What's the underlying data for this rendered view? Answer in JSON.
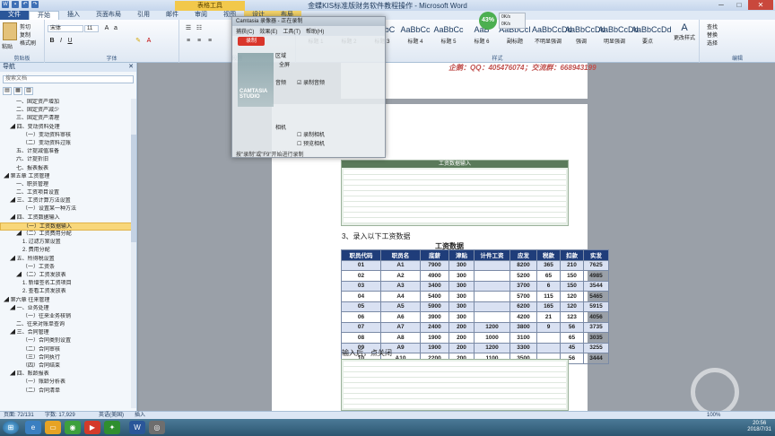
{
  "window": {
    "title": "金蝶KIS标准版财务软件教程操作 - Microsoft Word",
    "min": "─",
    "max": "□",
    "close": "✕"
  },
  "ribbon_tabs": [
    "文件",
    "开始",
    "插入",
    "页面布局",
    "引用",
    "邮件",
    "审阅",
    "视图",
    "设计",
    "布局"
  ],
  "ribbon_context": "表格工具",
  "ribbon": {
    "clipboard": {
      "label": "剪贴板",
      "paste": "粘贴",
      "cut": "剪切",
      "copy": "复制",
      "format_painter": "格式刷"
    },
    "font": {
      "label": "字体",
      "name": "宋体",
      "size": "11",
      "bold": "B",
      "italic": "I",
      "underline": "U"
    },
    "paragraph": {
      "label": "段落"
    },
    "styles": {
      "label": "样式",
      "items": [
        {
          "preview": "AaBb",
          "name": "标题 1"
        },
        {
          "preview": "AaBbC",
          "name": "标题 2"
        },
        {
          "preview": "AaBbC",
          "name": "标题 3"
        },
        {
          "preview": "AaBbCc",
          "name": "标题 4"
        },
        {
          "preview": "AaBbCc",
          "name": "标题 5"
        },
        {
          "preview": "AaB",
          "name": "标题 6"
        },
        {
          "preview": "AaBbCcI",
          "name": "副标题"
        },
        {
          "preview": "AaBbCcDd",
          "name": "不明显强调"
        },
        {
          "preview": "AaBbCcDd",
          "name": "强调"
        },
        {
          "preview": "AaBbCcDd",
          "name": "明显强调"
        },
        {
          "preview": "AaBbCcDd",
          "name": "要点"
        }
      ],
      "change": "更改样式"
    },
    "editing": {
      "label": "编辑",
      "find": "查找",
      "replace": "替换",
      "select": "选择"
    }
  },
  "nav": {
    "title": "导航",
    "search_placeholder": "搜索文档",
    "items": [
      {
        "t": "一、固定资产增加",
        "lv": 2
      },
      {
        "t": "二、固定资产减少",
        "lv": 2
      },
      {
        "t": "三、固定资产清理",
        "lv": 2
      },
      {
        "t": "◢ 四、变动资料处理",
        "lv": 1
      },
      {
        "t": "（一）变动资料审核",
        "lv": 3
      },
      {
        "t": "（二）变动资料过账",
        "lv": 3
      },
      {
        "t": "五、计提减值准备",
        "lv": 2
      },
      {
        "t": "六、计提折旧",
        "lv": 2
      },
      {
        "t": "七、报表报表",
        "lv": 2
      },
      {
        "t": "◢ 第五章 工资管理",
        "lv": 0
      },
      {
        "t": "一、职员管理",
        "lv": 2
      },
      {
        "t": "二、工资项目设置",
        "lv": 2
      },
      {
        "t": "◢ 三、工资计算方法设置",
        "lv": 1
      },
      {
        "t": "（一）设置某一种方法",
        "lv": 3
      },
      {
        "t": "◢ 四、工资数据输入",
        "lv": 1
      },
      {
        "t": "（一）工资数据输入",
        "lv": 3,
        "sel": true
      },
      {
        "t": "◢ （二）工资费用分配",
        "lv": 2
      },
      {
        "t": "1. 过滤方案设置",
        "lv": 3
      },
      {
        "t": "2. 费用分配",
        "lv": 3
      },
      {
        "t": "◢ 五、所得税设置",
        "lv": 1
      },
      {
        "t": "（一）工资条",
        "lv": 3
      },
      {
        "t": "◢ （二）工资发放表",
        "lv": 2
      },
      {
        "t": "1. 新增签名工资项目",
        "lv": 3
      },
      {
        "t": "2. 查看工资发放表",
        "lv": 3
      },
      {
        "t": "◢ 第六章 往来管理",
        "lv": 0
      },
      {
        "t": "◢ 一、业务处理",
        "lv": 1
      },
      {
        "t": "（一）往来业务核销",
        "lv": 3
      },
      {
        "t": "二、往来对账单查询",
        "lv": 2
      },
      {
        "t": "◢ 三、合同管理",
        "lv": 1
      },
      {
        "t": "（一）合同类别设置",
        "lv": 3
      },
      {
        "t": "（二）合同审核",
        "lv": 3
      },
      {
        "t": "（三）合同执行",
        "lv": 3
      },
      {
        "t": "（四）合同结束",
        "lv": 3
      },
      {
        "t": "◢ 四、账龄报表",
        "lv": 1
      },
      {
        "t": "（一）账龄分析表",
        "lv": 3
      },
      {
        "t": "（二）合同清单",
        "lv": 3
      }
    ]
  },
  "doc": {
    "header_contact": "企鹅：QQ：405476074；交流群：668943199",
    "step3": "3、录入以下工资数据",
    "table_title": "工资数据",
    "after_input": "输入后，点关闭",
    "headers": [
      "职员代码",
      "职员名",
      "底薪",
      "津贴",
      "计件工资",
      "应发",
      "税款",
      "扣款",
      "实发"
    ],
    "rows": [
      [
        "01",
        "A1",
        "7900",
        "300",
        "",
        "8200",
        "365",
        "210",
        "7625"
      ],
      [
        "02",
        "A2",
        "4900",
        "300",
        "",
        "5200",
        "65",
        "150",
        "4985"
      ],
      [
        "03",
        "A3",
        "3400",
        "300",
        "",
        "3700",
        "6",
        "150",
        "3544"
      ],
      [
        "04",
        "A4",
        "5400",
        "300",
        "",
        "5700",
        "115",
        "120",
        "5465"
      ],
      [
        "05",
        "A5",
        "5900",
        "300",
        "",
        "6200",
        "165",
        "120",
        "5915"
      ],
      [
        "06",
        "A6",
        "3900",
        "300",
        "",
        "4200",
        "21",
        "123",
        "4056"
      ],
      [
        "07",
        "A7",
        "2400",
        "200",
        "1200",
        "3800",
        "9",
        "56",
        "3735"
      ],
      [
        "08",
        "A8",
        "1900",
        "200",
        "1000",
        "3100",
        "",
        "65",
        "3035"
      ],
      [
        "09",
        "A9",
        "1900",
        "200",
        "1200",
        "3300",
        "",
        "45",
        "3255"
      ],
      [
        "10",
        "A10",
        "2200",
        "200",
        "1100",
        "3500",
        "",
        "56",
        "3444"
      ]
    ],
    "mock_title": "工资数据输入"
  },
  "camtasia": {
    "title": "Camtasia 录像器 - 正在录制",
    "menu": [
      "捕获(C)",
      "效果(E)",
      "工具(T)",
      "帮助(H)"
    ],
    "record": "录制",
    "area": "区域",
    "full_screen": "全屏",
    "screen": "屏幕",
    "audio": "音频",
    "record_audio": "录制音频",
    "webcam": "相机",
    "record_webcam": "录制相机",
    "preview": "预览相机",
    "hint": "按\"录制\"或\"F9\"开始进行录制",
    "watermark": "CAMTASIA STUDIO"
  },
  "status": {
    "page": "页面: 72/131",
    "words": "字数: 17,929",
    "lang": "英语(美国)",
    "insert": "插入",
    "zoom": "100%"
  },
  "speed": {
    "percent": "43%",
    "up": "0K/s",
    "down": "0K/s"
  },
  "clock": {
    "time": "20:56",
    "date": "2018/7/31"
  }
}
